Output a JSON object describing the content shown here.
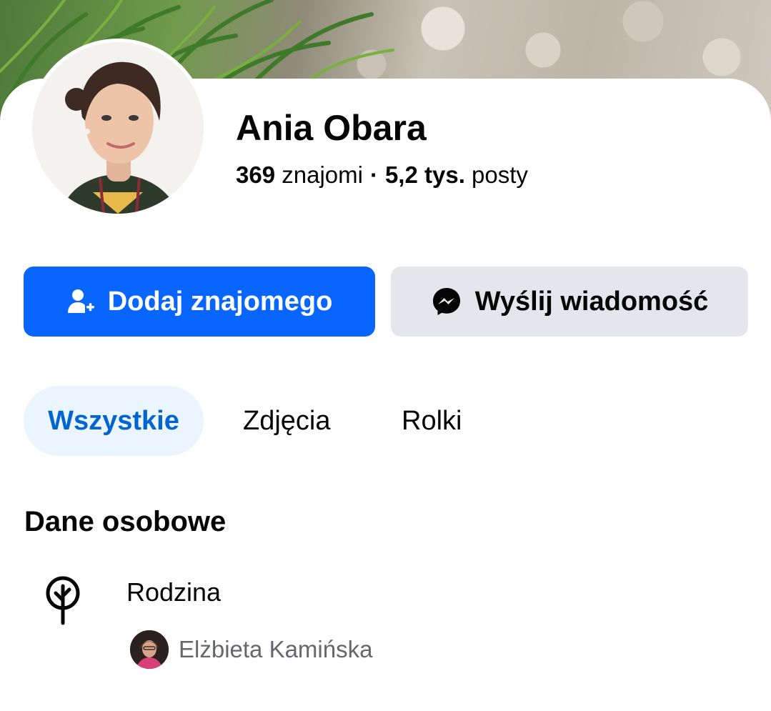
{
  "profile": {
    "name": "Ania Obara",
    "friends_count": "369",
    "friends_label": "znajomi",
    "separator": "·",
    "posts_count": "5,2 tys.",
    "posts_label": "posty"
  },
  "actions": {
    "add_friend_label": "Dodaj znajomego",
    "send_message_label": "Wyślij wiadomość"
  },
  "tabs": [
    {
      "label": "Wszystkie",
      "active": true
    },
    {
      "label": "Zdjęcia",
      "active": false
    },
    {
      "label": "Rolki",
      "active": false
    }
  ],
  "personal_details": {
    "title": "Dane osobowe",
    "family": {
      "label": "Rodzina",
      "members": [
        {
          "name": "Elżbieta Kamińska"
        }
      ]
    }
  },
  "colors": {
    "primary": "#0866ff",
    "secondary_button": "#e4e6eb",
    "active_tab_bg": "#ebf5ff",
    "active_tab_text": "#0064d1",
    "muted_text": "#65676b"
  },
  "icons": {
    "add_friend": "add-friend-icon",
    "messenger": "messenger-icon",
    "family": "tree-icon"
  }
}
